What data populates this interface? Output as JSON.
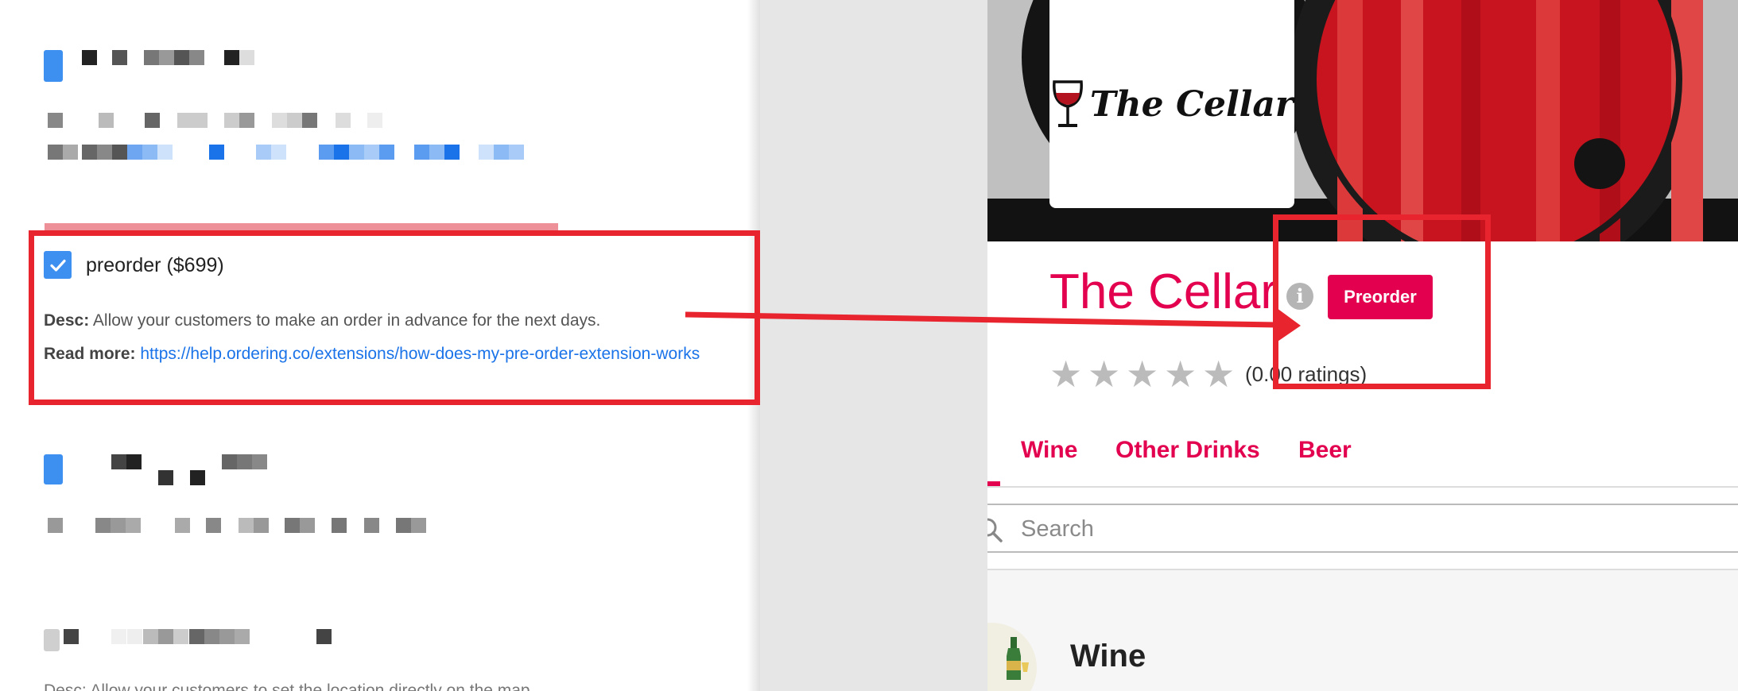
{
  "extension": {
    "name": "preorder ($699)",
    "checked": true,
    "desc_label": "Desc:",
    "desc_text": "Allow your customers to make an order in advance for the next days.",
    "read_more_label": "Read more:",
    "read_more_url": "https://help.ordering.co/extensions/how-does-my-pre-order-extension-works"
  },
  "store": {
    "logo_text": "The Cellar",
    "name": "The Cellar",
    "preorder_button": "Preorder",
    "rating_stars": 0,
    "ratings_text": "(0.00 ratings)"
  },
  "tabs": [
    {
      "label": "Wine",
      "active": true
    },
    {
      "label": "Other Drinks",
      "active": false
    },
    {
      "label": "Beer",
      "active": false
    }
  ],
  "search": {
    "placeholder": "Search"
  },
  "category": {
    "title": "Wine"
  },
  "colors": {
    "accent": "#e2004f",
    "highlight": "#e8242f",
    "checkbox": "#3d8ff0",
    "link": "#1a73e8"
  },
  "icons": [
    "check-icon",
    "wine-glass-icon",
    "info-icon",
    "star-icon",
    "search-icon",
    "champagne-bottle-icon",
    "arrow-icon"
  ]
}
